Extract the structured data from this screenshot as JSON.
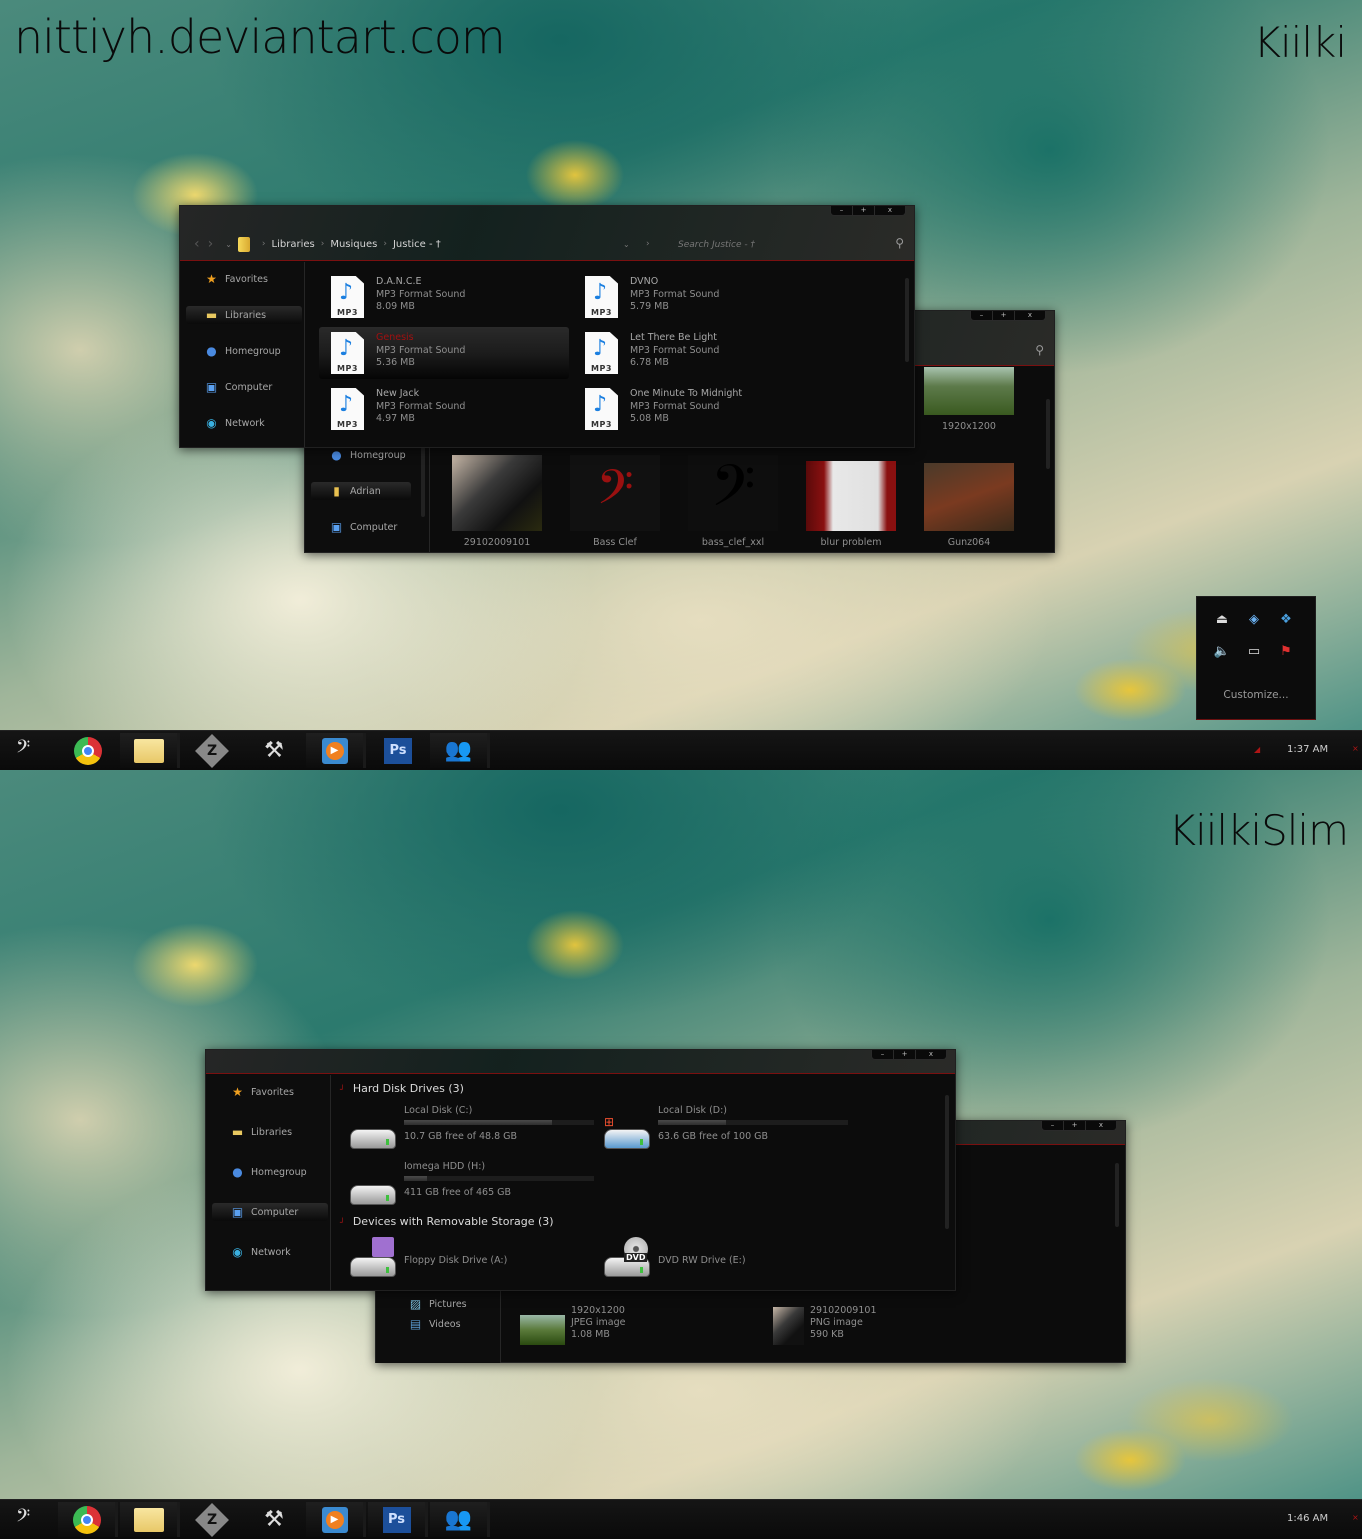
{
  "watermarks": {
    "site": "nittiyh.deviantart.com",
    "top_theme": "Kiilki",
    "bottom_theme": "KiilkiSlim"
  },
  "caption_buttons": {
    "minimize": "–",
    "maximize": "+",
    "close": "x"
  },
  "top_screen": {
    "explorer_front": {
      "breadcrumb": [
        "Libraries",
        "Musiques",
        "Justice - †"
      ],
      "search_placeholder": "Search Justice - †",
      "sidebar": [
        {
          "label": "Favorites",
          "icon": "star-icon",
          "selected": false
        },
        {
          "label": "Libraries",
          "icon": "libraries-icon",
          "selected": true
        },
        {
          "label": "Homegroup",
          "icon": "homegroup-icon",
          "selected": false
        },
        {
          "label": "Computer",
          "icon": "computer-icon",
          "selected": false
        },
        {
          "label": "Network",
          "icon": "network-icon",
          "selected": false
        }
      ],
      "files": [
        {
          "name": "D.A.N.C.E",
          "type": "MP3 Format Sound",
          "size": "8.09 MB",
          "selected": false
        },
        {
          "name": "Genesis",
          "type": "MP3 Format Sound",
          "size": "5.36 MB",
          "selected": true
        },
        {
          "name": "New Jack",
          "type": "MP3 Format Sound",
          "size": "4.97 MB",
          "selected": false
        },
        {
          "name": "DVNO",
          "type": "MP3 Format Sound",
          "size": "5.79 MB",
          "selected": false
        },
        {
          "name": "Let There Be Light",
          "type": "MP3 Format Sound",
          "size": "6.78 MB",
          "selected": false
        },
        {
          "name": "One Minute To Midnight",
          "type": "MP3 Format Sound",
          "size": "5.08 MB",
          "selected": false
        }
      ],
      "icon_label": "MP3"
    },
    "explorer_back": {
      "sidebar": [
        {
          "label": "Homegroup",
          "icon": "homegroup-icon",
          "selected": false
        },
        {
          "label": "Adrian",
          "icon": "user-folder-icon",
          "selected": true
        },
        {
          "label": "Computer",
          "icon": "computer-icon",
          "selected": false
        }
      ],
      "thumbnails": [
        {
          "label": "1920x1200",
          "kind": "landscape"
        },
        {
          "label": "29102009101",
          "kind": "photo"
        },
        {
          "label": "Bass Clef",
          "kind": "bass-clef-red"
        },
        {
          "label": "bass_clef_xxl",
          "kind": "bass-clef-black"
        },
        {
          "label": "blur problem",
          "kind": "screenshot"
        },
        {
          "label": "Gunz064",
          "kind": "game"
        }
      ]
    },
    "tray_popup": {
      "icons": [
        "usb-safe-remove-icon",
        "windows-update-icon",
        "dropbox-icon",
        "volume-icon",
        "network-icon",
        "action-center-flag-icon"
      ],
      "customize_label": "Customize..."
    },
    "taskbar": {
      "clock": "1:37 AM"
    }
  },
  "bottom_screen": {
    "explorer_front": {
      "sidebar": [
        {
          "label": "Favorites",
          "icon": "star-icon",
          "selected": false
        },
        {
          "label": "Libraries",
          "icon": "libraries-icon",
          "selected": false
        },
        {
          "label": "Homegroup",
          "icon": "homegroup-icon",
          "selected": false
        },
        {
          "label": "Computer",
          "icon": "computer-icon",
          "selected": true
        },
        {
          "label": "Network",
          "icon": "network-icon",
          "selected": false
        }
      ],
      "groups": [
        {
          "title": "Hard Disk Drives (3)"
        },
        {
          "title": "Devices with Removable Storage (3)"
        }
      ],
      "drives": [
        {
          "name": "Local Disk (C:)",
          "free": "10.7 GB free of 48.8 GB",
          "used_fraction": 0.78,
          "icon": "hdd-icon"
        },
        {
          "name": "Local Disk (D:)",
          "free": "63.6 GB free of 100 GB",
          "used_fraction": 0.36,
          "icon": "windows-hdd-icon"
        },
        {
          "name": "Iomega HDD (H:)",
          "free": "411 GB free of 465 GB",
          "used_fraction": 0.12,
          "icon": "hdd-icon"
        }
      ],
      "removable": [
        {
          "name": "Floppy Disk Drive (A:)",
          "icon": "floppy-drive-icon"
        },
        {
          "name": "DVD RW Drive (E:)",
          "icon": "dvd-drive-icon"
        }
      ]
    },
    "explorer_back": {
      "sidebar": [
        {
          "label": "Pictures",
          "icon": "pictures-icon"
        },
        {
          "label": "Videos",
          "icon": "videos-icon"
        }
      ],
      "files": [
        {
          "name": "1920x1200",
          "type": "JPEG image",
          "size": "1.08 MB"
        },
        {
          "name": "29102009101",
          "type": "PNG image",
          "size": "590 KB"
        }
      ]
    },
    "taskbar": {
      "clock": "1:46 AM"
    }
  },
  "taskbar_apps": [
    {
      "name": "chrome",
      "icon": "chrome-icon",
      "active": false
    },
    {
      "name": "windows-explorer",
      "icon": "folder-icon",
      "active": true
    },
    {
      "name": "z-utility",
      "icon": "z-shield-icon",
      "active": false
    },
    {
      "name": "tools",
      "icon": "tools-icon",
      "active": false
    },
    {
      "name": "media-player",
      "icon": "media-player-icon",
      "active": true
    },
    {
      "name": "photoshop",
      "icon": "photoshop-icon",
      "label": "Ps",
      "active": false
    },
    {
      "name": "messenger",
      "icon": "messenger-icon",
      "active": true
    }
  ],
  "start_glyph": "𝄢"
}
